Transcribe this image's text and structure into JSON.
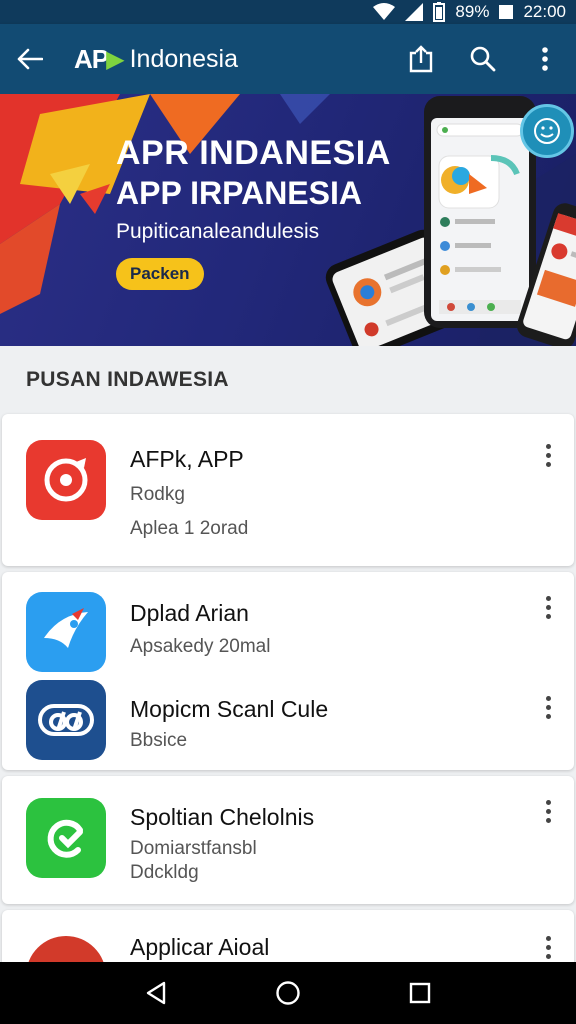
{
  "status_bar": {
    "battery": "89%",
    "time": "22:00"
  },
  "app_bar": {
    "logo": "AP",
    "title": "Indonesia"
  },
  "banner": {
    "line1": "APR INDANESIA",
    "line2": "APP IRPANESIA",
    "line3": "Pupiticanaleandulesis",
    "button": "Packen"
  },
  "section": {
    "title": "PUSAN INDAWESIA"
  },
  "apps": [
    {
      "name": "AFPk, APP",
      "sub1": "Rodkg",
      "sub2": "Aplea 1 2orad",
      "icon_color": "#e8392f"
    },
    {
      "name": "Dplad Arian",
      "sub1": "Apsakedy 20mal",
      "icon_color": "#2b9ef0"
    },
    {
      "name": "Mopicm Scanl Cule",
      "sub1": "Bbsice",
      "icon_color": "#1e4f8f"
    },
    {
      "name": "Spoltian Chelolnis",
      "sub1": "Domiarstfansbl",
      "sub2": "Ddckldg",
      "icon_color": "#2cc23f"
    },
    {
      "name": "Applicar Aioal",
      "icon_color": "#d23a2a"
    }
  ],
  "colors": {
    "app_bar": "#124b73",
    "status_bar": "#0f3a5c",
    "banner_button": "#f6c21a"
  }
}
